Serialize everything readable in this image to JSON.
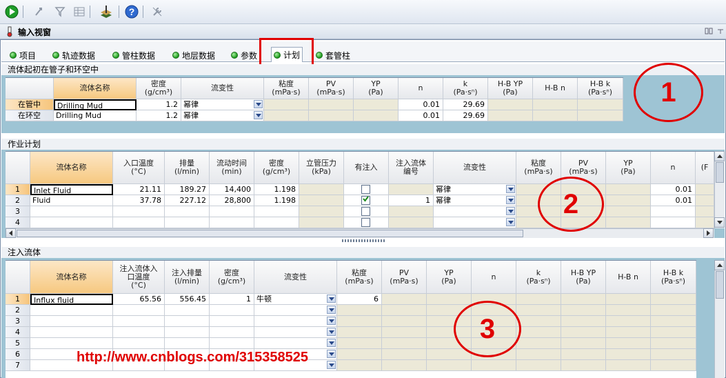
{
  "toolbar": {
    "icons": [
      "run-icon",
      "pointer-icon",
      "filter-icon",
      "data-icon",
      "well-icon",
      "help-icon",
      "wrench-icon"
    ]
  },
  "window": {
    "title": "输入视窗"
  },
  "tabs": [
    {
      "label": "项目"
    },
    {
      "label": "轨迹数据"
    },
    {
      "label": "管柱数据"
    },
    {
      "label": "地层数据"
    },
    {
      "label": "参数"
    },
    {
      "label": "计划"
    },
    {
      "label": "套管柱"
    }
  ],
  "section1": {
    "title": "流体起初在管子和环空中",
    "headers": [
      "流体名称",
      "密度\n(g/cm³)",
      "流变性",
      "粘度\n(mPa·s)",
      "PV\n(mPa·s)",
      "YP\n(Pa)",
      "n",
      "k\n(Pa·sⁿ)",
      "H-B YP\n(Pa)",
      "H-B n",
      "H-B k\n(Pa·sⁿ)"
    ],
    "rows": [
      {
        "label": "在管中",
        "name": "Drilling Mud",
        "density": "1.2",
        "rheology": "幂律",
        "n": "0.01",
        "k": "29.69"
      },
      {
        "label": "在环空",
        "name": "Drilling Mud",
        "density": "1.2",
        "rheology": "幂律",
        "n": "0.01",
        "k": "29.69"
      }
    ]
  },
  "section2": {
    "title": "作业计划",
    "headers": [
      "流体名称",
      "入口温度\n(°C)",
      "排量\n(l/min)",
      "流动时间\n(min)",
      "密度\n(g/cm³)",
      "立管压力\n(kPa)",
      "有注入",
      "注入流体\n编号",
      "流变性",
      "粘度\n(mPa·s)",
      "PV\n(mPa·s)",
      "YP\n(Pa)",
      "n",
      "(F"
    ],
    "rows": [
      {
        "num": "1",
        "name": "Inlet Fluid",
        "temp": "21.11",
        "rate": "189.27",
        "time": "14,400",
        "density": "1.198",
        "injected": false,
        "injnum": "",
        "rheology": "幂律",
        "n": "0.01"
      },
      {
        "num": "2",
        "name": "Fluid",
        "temp": "37.78",
        "rate": "227.12",
        "time": "28,800",
        "density": "1.198",
        "injected": true,
        "injnum": "1",
        "rheology": "幂律",
        "n": "0.01"
      },
      {
        "num": "3"
      },
      {
        "num": "4"
      }
    ]
  },
  "section3": {
    "title": "注入流体",
    "headers": [
      "流体名称",
      "注入流体入\n口温度\n(°C)",
      "注入排量\n(l/min)",
      "密度\n(g/cm³)",
      "流变性",
      "粘度\n(mPa·s)",
      "PV\n(mPa·s)",
      "YP\n(Pa)",
      "n",
      "k\n(Pa·sⁿ)",
      "H-B YP\n(Pa)",
      "H-B n",
      "H-B k\n(Pa·sⁿ)"
    ],
    "rows": [
      {
        "num": "1",
        "name": "Influx fluid",
        "temp": "65.56",
        "rate": "556.45",
        "density": "1",
        "rheology": "牛顿",
        "visc": "6"
      },
      {
        "num": "2"
      },
      {
        "num": "3"
      },
      {
        "num": "4"
      },
      {
        "num": "5"
      },
      {
        "num": "6"
      },
      {
        "num": "7"
      }
    ]
  },
  "annotations": {
    "one": "1",
    "two": "2",
    "three": "3"
  },
  "watermark": "http://www.cnblogs.com/315358525",
  "colors": {
    "accent": "#e00000",
    "panel": "#9ec4d4",
    "readonly": "#ece9d8",
    "header_selected": "#f6c880"
  }
}
